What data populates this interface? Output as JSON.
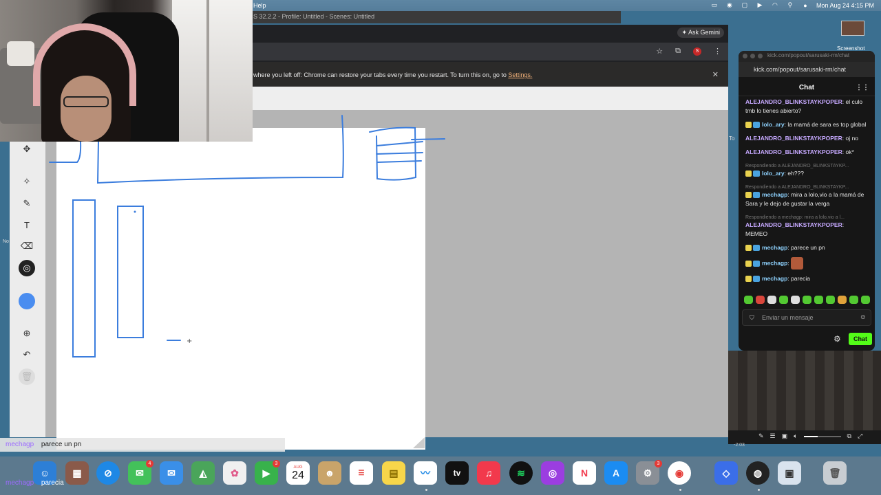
{
  "menubar": {
    "help": "Help",
    "clock": "Mon Aug 24  4:15 PM"
  },
  "obs": {
    "title": "S 32.2.2 - Profile: Untitled - Scenes: Untitled"
  },
  "chrome": {
    "ask_gemini": "Ask Gemini",
    "profile_initial": "S",
    "infobar_text": "where you left off: Chrome can restore your tabs every time you restart. To turn this on, go to",
    "infobar_link": "Settings.",
    "close": "✕"
  },
  "desktop": {
    "screenshot_label": "Screenshot"
  },
  "side_stubs": {
    "right": "To",
    "left": "No"
  },
  "kick": {
    "window_title": "kick.com/popout/sarusaki-rm/chat",
    "url": "kick.com/popout/sarusaki-rm/chat",
    "header": "Chat",
    "messages": [
      {
        "user": "ALEJANDRO_BLINKSTAYKPOPER",
        "text": "el culo tmb lo tienes abierto?",
        "reply": ""
      },
      {
        "user": "lolo_ary",
        "text": "la mamá de sara es top global",
        "reply": ""
      },
      {
        "user": "ALEJANDRO_BLINKSTAYKPOPER",
        "text": "oj no",
        "reply": ""
      },
      {
        "user": "ALEJANDRO_BLINKSTAYKPOPER",
        "text": "ok*",
        "reply": ""
      },
      {
        "user": "lolo_ary",
        "text": "eh???",
        "reply": "Respondiendo a ALEJANDRO_BLINKSTAYKP..."
      },
      {
        "user": "mechagp",
        "text": "mira a lolo,vio a la mamá de Sara y le dejo de gustar la verga",
        "reply": "Respondiendo a ALEJANDRO_BLINKSTAYKP..."
      },
      {
        "user": "ALEJANDRO_BLINKSTAYKPOPER",
        "text": "MEMEO",
        "reply": "Respondiendo a mechagp: mira a lolo,vio a l..."
      },
      {
        "user": "mechagp",
        "text": "parece un pn",
        "reply": ""
      },
      {
        "user": "mechagp",
        "text": "",
        "reply": ""
      },
      {
        "user": "mechagp",
        "text": "parecia",
        "reply": ""
      }
    ],
    "input_placeholder": "Enviar un mensaje",
    "chat_button": "Chat"
  },
  "player": {
    "time": "-2:03"
  },
  "ticker": {
    "user": "mechagp",
    "text": "parece un pn",
    "user2": "mechagp",
    "text2": "parecia"
  },
  "dock": {
    "calendar_month": "AUG",
    "calendar_day": "24",
    "messages_badge": "4",
    "facetime_badge": "3",
    "settings_badge": "3",
    "appletv_label": "tv"
  },
  "colors": {
    "stroke_blue": "#1971c2",
    "kick_green": "#53fc18"
  }
}
